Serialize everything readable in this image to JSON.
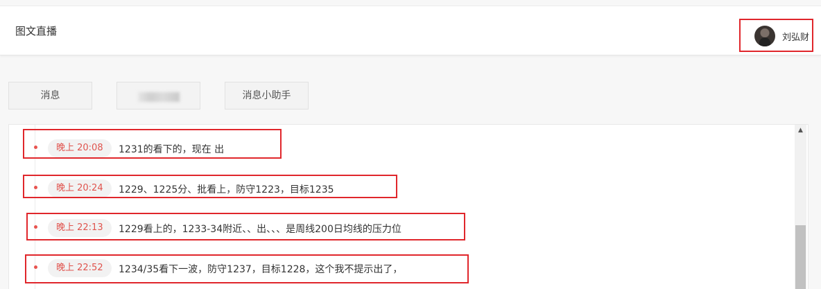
{
  "header": {
    "title": "图文直播",
    "user": {
      "name": "刘弘财",
      "avatar_icon": "avatar"
    }
  },
  "tabs": [
    {
      "label": "消息"
    },
    {
      "label": ""
    },
    {
      "label": "消息小助手"
    }
  ],
  "messages": [
    {
      "time": "晚上 20:08",
      "text": "1231的看下的，现在 出"
    },
    {
      "time": "晚上 20:24",
      "text": "1229、1225分、批看上，防守1223，目标1235"
    },
    {
      "time": "晚上 22:13",
      "text": "1229看上的，1233-34附近、、出、、、是周线200日均线的压力位"
    },
    {
      "time": "晚上 22:52",
      "text": "1234/35看下一波，防守1237，目标1228，这个我不提示出了，"
    }
  ],
  "colors": {
    "accent_red": "#e0262b",
    "time_text": "#e0534d",
    "timeline_dot": "#e8534f"
  },
  "scrollbar": {
    "up_icon": "scroll-up-arrow-icon"
  }
}
